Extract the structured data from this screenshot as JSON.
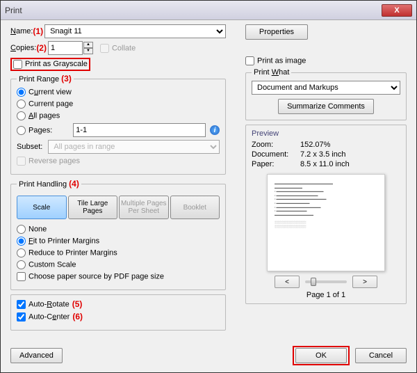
{
  "title": "Print",
  "close_x": "X",
  "labels": {
    "name": "Name:",
    "copies": "Copies:",
    "collate": "Collate",
    "print_grayscale": "Print as Grayscale",
    "print_as_image": "Print as image",
    "print_range": "Print Range",
    "current_view": "Current view",
    "current_page": "Current page",
    "all_pages": "All pages",
    "pages": "Pages:",
    "subset": "Subset:",
    "reverse_pages": "Reverse pages",
    "print_handling": "Print Handling",
    "none": "None",
    "fit_margins": "Fit to Printer Margins",
    "reduce_margins": "Reduce to Printer Margins",
    "custom_scale": "Custom Scale",
    "choose_paper": "Choose paper source by PDF page size",
    "auto_rotate": "Auto-Rotate",
    "auto_center": "Auto-Center",
    "print_what": "Print What",
    "preview": "Preview",
    "zoom": "Zoom:",
    "document": "Document:",
    "paper": "Paper:"
  },
  "annotations": {
    "a1": "(1)",
    "a2": "(2)",
    "a3": "(3)",
    "a4": "(4)",
    "a5": "(5)",
    "a6": "(6)"
  },
  "values": {
    "printer": "Snagit 11",
    "copies": "1",
    "pages_range": "1-1",
    "subset": "All pages in range",
    "print_what": "Document and Markups",
    "zoom": "152.07%",
    "document_size": "7.2 x 3.5 inch",
    "paper_size": "8.5 x 11.0 inch",
    "page_nav": "Page 1 of 1"
  },
  "buttons": {
    "properties": "Properties",
    "summarize": "Summarize Comments",
    "advanced": "Advanced",
    "ok": "OK",
    "cancel": "Cancel",
    "prev": "<",
    "next": ">"
  },
  "seg": {
    "scale": "Scale",
    "tile": "Tile Large\nPages",
    "multiple": "Multiple Pages\nPer Sheet",
    "booklet": "Booklet"
  }
}
